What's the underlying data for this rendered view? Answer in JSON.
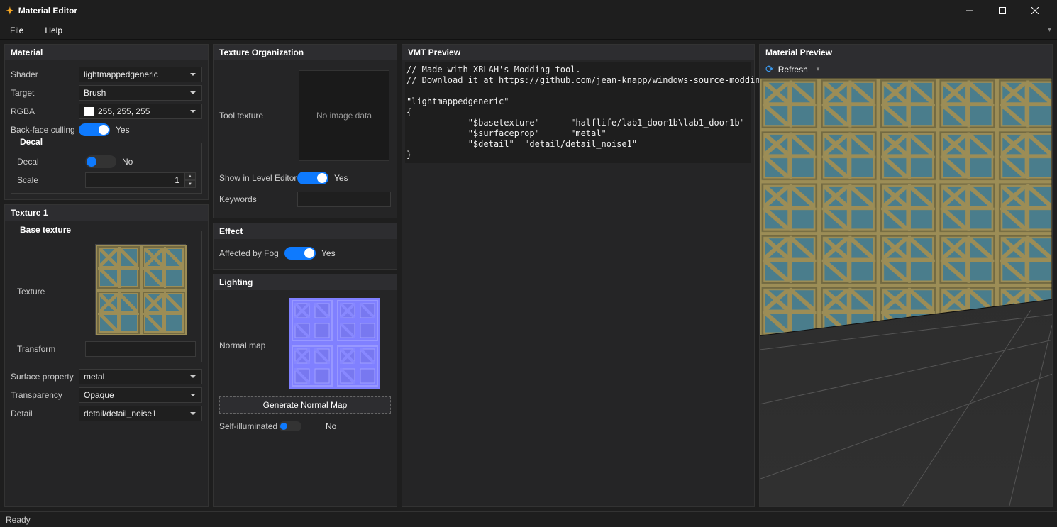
{
  "titlebar": {
    "app_title": "Material Editor"
  },
  "menubar": {
    "file": "File",
    "help": "Help"
  },
  "material": {
    "header": "Material",
    "shader_lbl": "Shader",
    "shader_val": "lightmappedgeneric",
    "target_lbl": "Target",
    "target_val": "Brush",
    "rgba_lbl": "RGBA",
    "rgba_val": "255, 255, 255",
    "bfc_lbl": "Back-face culling",
    "bfc_val": "Yes",
    "decal_legend": "Decal",
    "decal_lbl": "Decal",
    "decal_val": "No",
    "scale_lbl": "Scale",
    "scale_val": "1"
  },
  "texture1": {
    "header": "Texture 1",
    "base_legend": "Base texture",
    "texture_lbl": "Texture",
    "transform_lbl": "Transform",
    "transform_val": "",
    "surfprop_lbl": "Surface property",
    "surfprop_val": "metal",
    "transp_lbl": "Transparency",
    "transp_val": "Opaque",
    "detail_lbl": "Detail",
    "detail_val": "detail/detail_noise1"
  },
  "texorg": {
    "header": "Texture Organization",
    "tooltex_lbl": "Tool texture",
    "noimg": "No image data",
    "showlvl_lbl": "Show in Level Editor",
    "showlvl_val": "Yes",
    "keywords_lbl": "Keywords",
    "keywords_val": ""
  },
  "effect": {
    "header": "Effect",
    "fog_lbl": "Affected by Fog",
    "fog_val": "Yes"
  },
  "lighting": {
    "header": "Lighting",
    "normal_lbl": "Normal map",
    "gen_btn": "Generate Normal Map",
    "selfill_lbl": "Self-illuminated",
    "selfill_val": "No"
  },
  "vmt": {
    "header": "VMT Preview",
    "l1": "// Made with XBLAH's Modding tool.",
    "l2": "// Download it at https://github.com/jean-knapp/windows-source-modding-tool/releases",
    "l3": "",
    "l4": "\"lightmappedgeneric\"",
    "l5": "{",
    "l6": "            \"$basetexture\"      \"halflife/lab1_door1b\\lab1_door1b\"",
    "l7": "            \"$surfaceprop\"      \"metal\"",
    "l8": "            \"$detail\"  \"detail/detail_noise1\"",
    "l9": "}"
  },
  "preview": {
    "header": "Material Preview",
    "refresh": "Refresh"
  },
  "status": {
    "ready": "Ready"
  }
}
